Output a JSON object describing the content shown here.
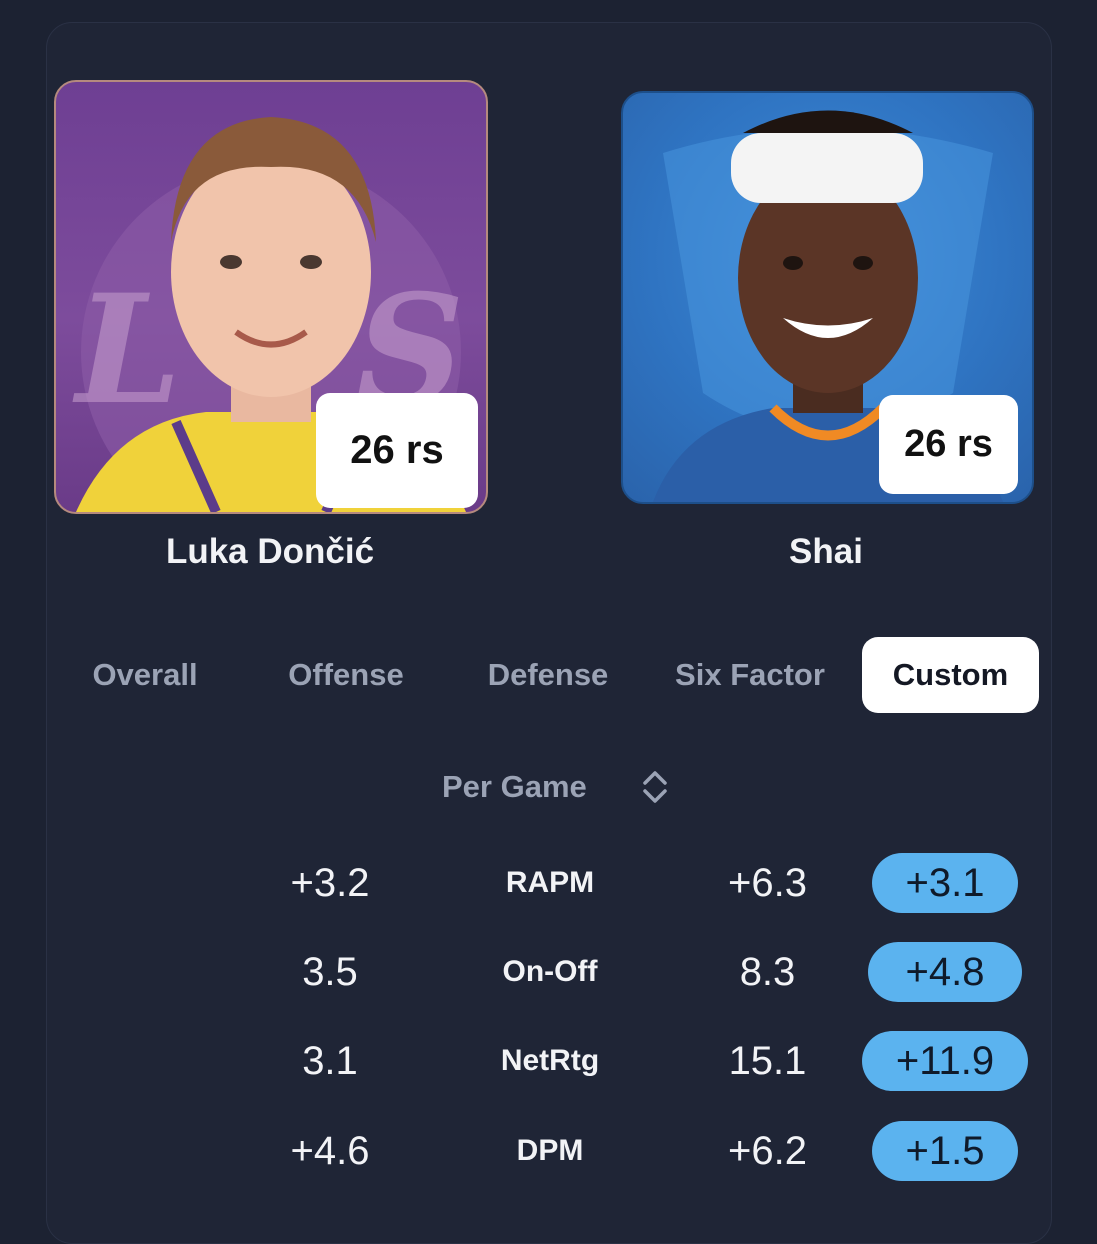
{
  "players": [
    {
      "name": "Luka Dončić",
      "badge": "26 rs"
    },
    {
      "name": "Shai",
      "badge": "26 rs"
    }
  ],
  "tabs": [
    {
      "label": "Overall",
      "selected": false
    },
    {
      "label": "Offense",
      "selected": false
    },
    {
      "label": "Defense",
      "selected": false
    },
    {
      "label": "Six Factor",
      "selected": false
    },
    {
      "label": "Custom",
      "selected": true
    }
  ],
  "mode_selector": {
    "label": "Per Game",
    "icon": "chevron-up-down-icon"
  },
  "stats": [
    {
      "metric": "RAPM",
      "left": "+3.2",
      "right": "+6.3",
      "diff": "+3.1"
    },
    {
      "metric": "On-Off",
      "left": "3.5",
      "right": "8.3",
      "diff": "+4.8"
    },
    {
      "metric": "NetRtg",
      "left": "3.1",
      "right": "15.1",
      "diff": "+11.9"
    },
    {
      "metric": "DPM",
      "left": "+4.6",
      "right": "+6.2",
      "diff": "+1.5"
    }
  ],
  "colors": {
    "background": "#1c2232",
    "diff_pill": "#5bb3ef",
    "selected_tab": "#ffffff",
    "luka_photo_bg": "#7d4c9c",
    "shai_photo_bg": "#2f74c2"
  }
}
